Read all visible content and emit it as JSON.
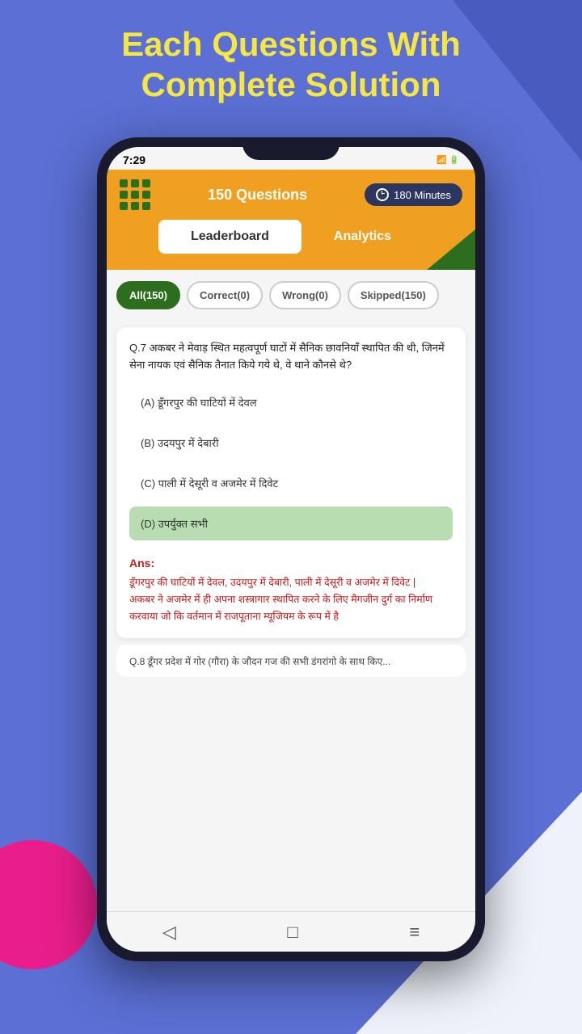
{
  "page": {
    "background_color": "#5b6fd4",
    "header_text_line1": "Each Questions With",
    "header_text_line2": "Complete Solution"
  },
  "status_bar": {
    "time": "7:29",
    "icons": "📶 🔋"
  },
  "app_header": {
    "title": "150 Questions",
    "timer_label": "180 Minutes"
  },
  "tabs": [
    {
      "id": "leaderboard",
      "label": "Leaderboard",
      "active": false
    },
    {
      "id": "analytics",
      "label": "Analytics",
      "active": true
    }
  ],
  "filters": [
    {
      "id": "all",
      "label": "All(150)",
      "active": true
    },
    {
      "id": "correct",
      "label": "Correct(0)",
      "active": false
    },
    {
      "id": "wrong",
      "label": "Wrong(0)",
      "active": false
    },
    {
      "id": "skipped",
      "label": "Skipped(150)",
      "active": false
    }
  ],
  "question": {
    "number": "Q.7",
    "text": "अकबर ने मेवाड़ स्थित महत्वपूर्ण घाटों में सैनिक छावनियाँ स्थापित की थी, जिनमें सेना नायक एवं सैनिक तैनात किये गये थे, वे थाने कौनसे थे?",
    "options": [
      {
        "id": "A",
        "label": "(A) डूँगरपुर की घाटियों में देवल",
        "correct": false
      },
      {
        "id": "B",
        "label": "(B) उदयपुर में देबारी",
        "correct": false
      },
      {
        "id": "C",
        "label": "(C) पाली में देसूरी व अजमेर में दिवेट",
        "correct": false
      },
      {
        "id": "D",
        "label": "(D) उपर्युक्त सभी",
        "correct": true
      }
    ],
    "answer_label": "Ans:",
    "answer_text": "डूँगरपुर की घाटियों में देवल, उदयपुर में देबारी, पाली में देसूरी व अजमेर में दिवेट |\nअकबर ने अजमेर में ही अपना शस्त्रागार स्थापित करने के लिए मैगजीन दुर्ग का निर्माण करवाया जो कि वर्तमान में राजपूताना म्यूजियम के रूप में है"
  },
  "next_question_peek": "Q.8 डूँगर प्रदेश में गोर (गौरा) के जौदन गज की सभी डंगरांगो के साथ किए...",
  "bottom_nav": {
    "back_icon": "◁",
    "home_icon": "□",
    "menu_icon": "≡"
  }
}
